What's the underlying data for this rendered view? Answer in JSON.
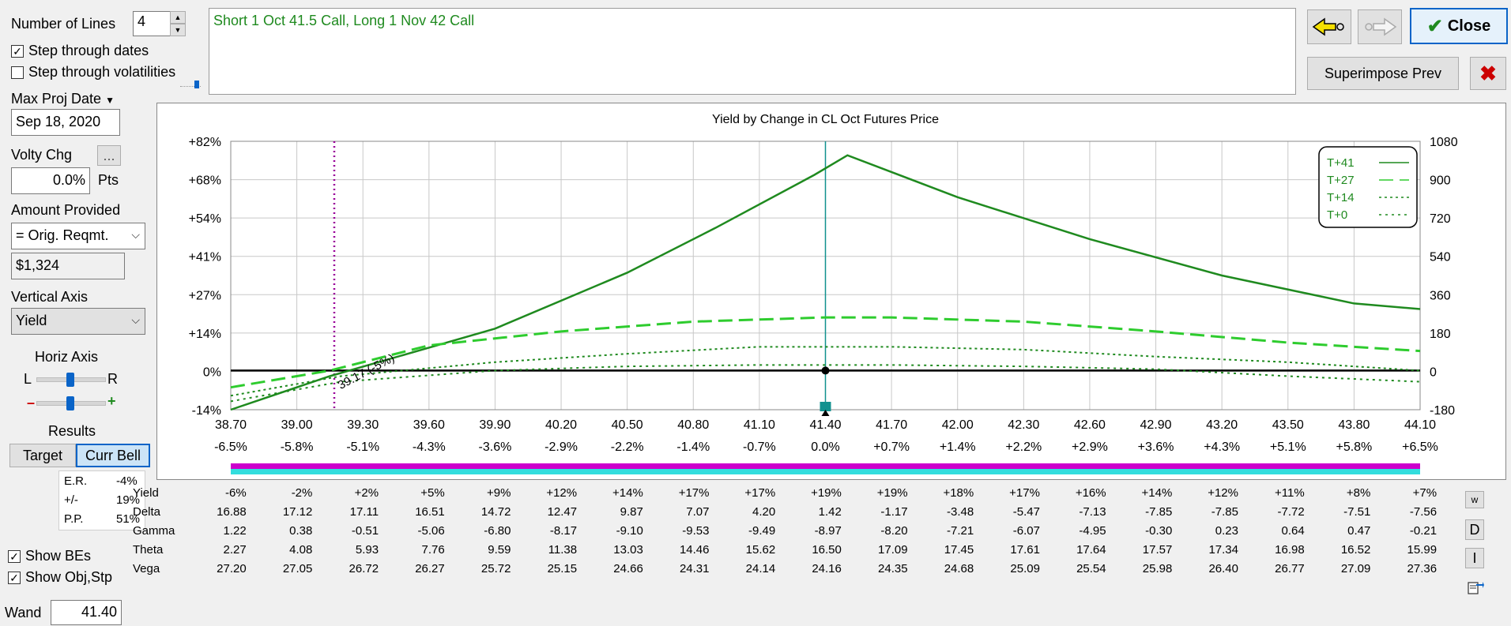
{
  "controls": {
    "num_lines_label": "Number of Lines",
    "num_lines_value": "4",
    "step_dates_label": "Step through dates",
    "step_dates_checked": true,
    "step_vols_label": "Step through volatilities",
    "step_vols_checked": false,
    "max_proj_date_label": "Max Proj Date",
    "max_proj_date_value": "Sep 18, 2020",
    "volty_chg_label": "Volty Chg",
    "volty_chg_button": "...",
    "volty_chg_value": "0.0%",
    "volty_chg_unit": "Pts",
    "amount_provided_label": "Amount Provided",
    "amount_provided_value": "= Orig. Reqmt.",
    "amount_value": "$1,324",
    "vertical_axis_label": "Vertical Axis",
    "vertical_axis_value": "Yield",
    "horiz_axis_label": "Horiz Axis",
    "horiz_l": "L",
    "horiz_r": "R",
    "zoom_minus": "–",
    "zoom_plus": "+",
    "results_label": "Results",
    "results_tabs": [
      "Target",
      "Curr Bell"
    ],
    "results_active": "Curr Bell",
    "er_label": "E.R.",
    "er_value": "-4%",
    "pm_label": "+/-",
    "pm_value": "19%",
    "pp_label": "P.P.",
    "pp_value": "51%",
    "show_bes_label": "Show BEs",
    "show_bes_checked": true,
    "show_obj_label": "Show Obj,Stp",
    "show_obj_checked": true,
    "wand_label": "Wand",
    "wand_value": "41.40"
  },
  "description": "Short 1 Oct 41.5 Call, Long 1 Nov 42 Call",
  "toolbar": {
    "close_label": "Close",
    "superimpose_label": "Superimpose Prev"
  },
  "side_buttons": [
    "w",
    "D",
    "I"
  ],
  "colors": {
    "dark_green": "#1f8a1f",
    "light_green": "#2ecc2e",
    "accent_blue": "#0a64c8",
    "magenta": "#cc00cc",
    "cyan": "#33dddd",
    "teal": "#11918f"
  },
  "chart_data": {
    "type": "line",
    "title": "Yield by Change in CL Oct Futures Price",
    "x": [
      38.7,
      39.0,
      39.3,
      39.6,
      39.9,
      40.2,
      40.5,
      40.8,
      41.1,
      41.4,
      41.7,
      42.0,
      42.3,
      42.6,
      42.9,
      43.2,
      43.5,
      43.8,
      44.1
    ],
    "x_tick_labels": [
      "38.70",
      "39.00",
      "39.30",
      "39.60",
      "39.90",
      "40.20",
      "40.50",
      "40.80",
      "41.10",
      "41.40",
      "41.70",
      "42.00",
      "42.30",
      "42.60",
      "42.90",
      "43.20",
      "43.50",
      "43.80",
      "44.10"
    ],
    "x_pct_labels": [
      "-6.5%",
      "-5.8%",
      "-5.1%",
      "-4.3%",
      "-3.6%",
      "-2.9%",
      "-2.2%",
      "-1.4%",
      "-0.7%",
      "0.0%",
      "+0.7%",
      "+1.4%",
      "+2.2%",
      "+2.9%",
      "+3.6%",
      "+4.3%",
      "+5.1%",
      "+5.8%",
      "+6.5%"
    ],
    "y_left_labels": [
      "+82%",
      "+68%",
      "+54%",
      "+41%",
      "+27%",
      "+14%",
      "0%",
      "-14%"
    ],
    "y_right_labels": [
      "1080",
      "900",
      "720",
      "540",
      "360",
      "180",
      "0",
      "-180"
    ],
    "ylim": [
      -14,
      82
    ],
    "legend": [
      {
        "name": "T+41",
        "style": "solid"
      },
      {
        "name": "T+27",
        "style": "long-dash"
      },
      {
        "name": "T+14",
        "style": "dotted"
      },
      {
        "name": "T+0",
        "style": "dotted"
      }
    ],
    "legend_position": "top-right",
    "series": [
      {
        "name": "T+41",
        "x": [
          38.7,
          39.15,
          39.9,
          40.5,
          40.9,
          41.35,
          41.5,
          42.0,
          42.6,
          43.2,
          43.8,
          44.1
        ],
        "values": [
          -14,
          -2,
          15,
          35,
          51,
          70,
          77,
          62,
          47,
          34,
          24,
          22
        ]
      },
      {
        "name": "T+27",
        "x": [
          38.7,
          39.15,
          39.6,
          40.2,
          40.8,
          41.4,
          41.7,
          42.3,
          42.9,
          43.5,
          44.1
        ],
        "values": [
          -6,
          0,
          9,
          14,
          17.5,
          19,
          19,
          17.5,
          14,
          10,
          7
        ]
      },
      {
        "name": "T+14",
        "x": [
          38.7,
          39.2,
          39.9,
          40.5,
          41.1,
          41.7,
          42.3,
          42.9,
          43.5,
          44.1
        ],
        "values": [
          -9,
          -2,
          3,
          6,
          8.5,
          8.5,
          7.5,
          5,
          3,
          0
        ]
      },
      {
        "name": "T+0",
        "x": [
          38.7,
          39.2,
          39.9,
          40.5,
          41.1,
          41.7,
          42.3,
          42.9,
          43.5,
          44.1
        ],
        "values": [
          -11,
          -4,
          0,
          1.5,
          2,
          2,
          1.5,
          0.5,
          -2,
          -4
        ]
      }
    ],
    "markers": {
      "breakeven_x": 39.17,
      "breakeven_label": "39.17 (-5%)",
      "current_price_x": 41.4
    }
  },
  "table": {
    "rows": [
      {
        "label": "Yield",
        "values": [
          "-6%",
          "-2%",
          "+2%",
          "+5%",
          "+9%",
          "+12%",
          "+14%",
          "+17%",
          "+17%",
          "+19%",
          "+19%",
          "+18%",
          "+17%",
          "+16%",
          "+14%",
          "+12%",
          "+11%",
          "+8%",
          "+7%"
        ]
      },
      {
        "label": "Delta",
        "values": [
          "16.88",
          "17.12",
          "17.11",
          "16.51",
          "14.72",
          "12.47",
          "9.87",
          "7.07",
          "4.20",
          "1.42",
          "-1.17",
          "-3.48",
          "-5.47",
          "-7.13",
          "-7.85",
          "-7.85",
          "-7.72",
          "-7.51",
          "-7.56"
        ]
      },
      {
        "label": "Gamma",
        "values": [
          "1.22",
          "0.38",
          "-0.51",
          "-5.06",
          "-6.80",
          "-8.17",
          "-9.10",
          "-9.53",
          "-9.49",
          "-8.97",
          "-8.20",
          "-7.21",
          "-6.07",
          "-4.95",
          "-0.30",
          "0.23",
          "0.64",
          "0.47",
          "-0.21"
        ]
      },
      {
        "label": "Theta",
        "values": [
          "2.27",
          "4.08",
          "5.93",
          "7.76",
          "9.59",
          "11.38",
          "13.03",
          "14.46",
          "15.62",
          "16.50",
          "17.09",
          "17.45",
          "17.61",
          "17.64",
          "17.57",
          "17.34",
          "16.98",
          "16.52",
          "15.99"
        ]
      },
      {
        "label": "Vega",
        "values": [
          "27.20",
          "27.05",
          "26.72",
          "26.27",
          "25.72",
          "25.15",
          "24.66",
          "24.31",
          "24.14",
          "24.16",
          "24.35",
          "24.68",
          "25.09",
          "25.54",
          "25.98",
          "26.40",
          "26.77",
          "27.09",
          "27.36"
        ]
      }
    ]
  }
}
